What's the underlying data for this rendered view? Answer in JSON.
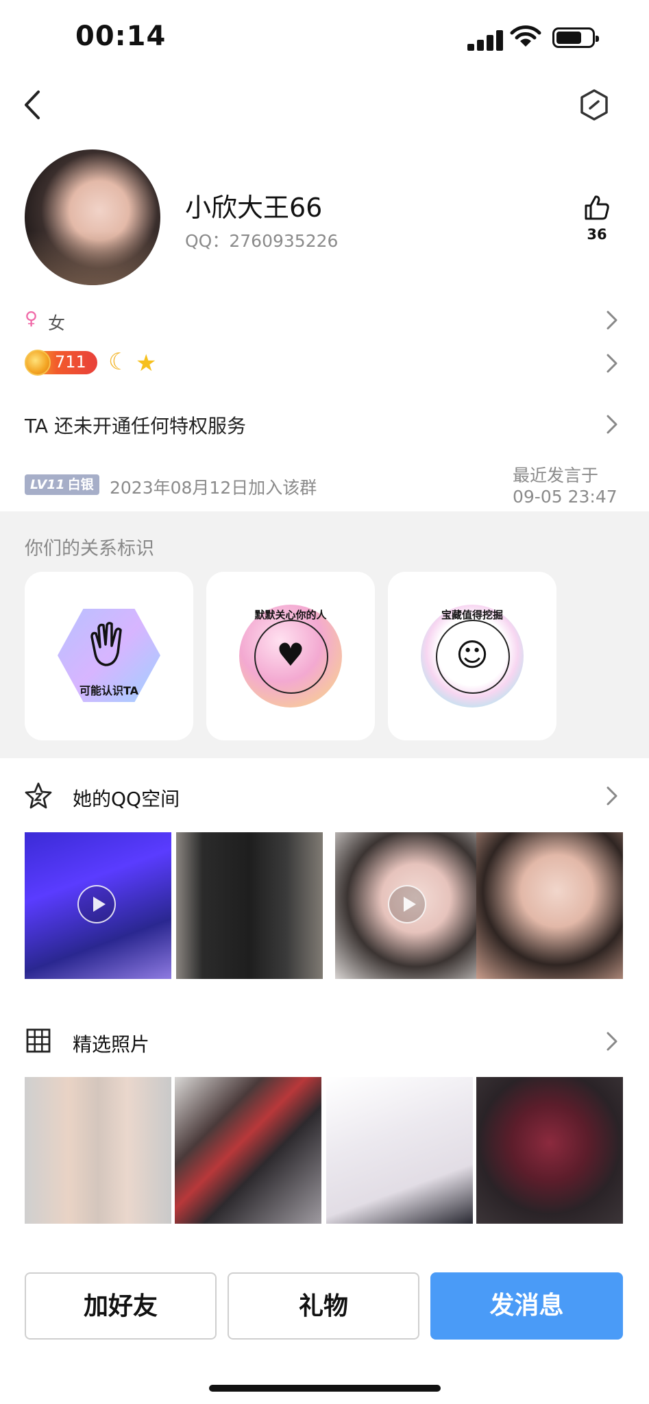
{
  "status_bar": {
    "time": "00:14"
  },
  "profile": {
    "name": "小欣大王66",
    "qq": "QQ：2760935226",
    "likes": "36"
  },
  "info": {
    "gender_symbol": "♀",
    "gender": "女",
    "level": "711",
    "privilege": "TA 还未开通任何特权服务",
    "lv_prefix": "LV11",
    "lv_rank": "白银",
    "join_date": "2023年08月12日加入该群",
    "last_speak_label": "最近发言于",
    "last_speak_time": "09-05 23:47"
  },
  "relation": {
    "title": "你们的关系标识",
    "badges": [
      {
        "label": "可能认识TA"
      },
      {
        "label": "默默关心你的人"
      },
      {
        "label": "宝藏值得挖掘"
      }
    ]
  },
  "qzone": {
    "title": "她的QQ空间"
  },
  "photos": {
    "title": "精选照片"
  },
  "buttons": {
    "add_friend": "加好友",
    "gift": "礼物",
    "message": "发消息"
  }
}
